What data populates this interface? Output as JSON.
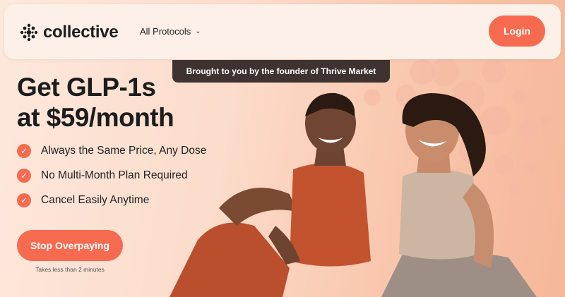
{
  "header": {
    "logo_text": "collective",
    "nav_label": "All Protocols",
    "login_label": "Login"
  },
  "banner": {
    "text": "Brought to you by the founder of Thrive Market"
  },
  "hero": {
    "headline_line1": "Get GLP-1s",
    "headline_line2": "at $59/month",
    "features": [
      {
        "label": "Always the Same Price, Any Dose"
      },
      {
        "label": "No Multi-Month Plan Required"
      },
      {
        "label": "Cancel Easily Anytime"
      }
    ],
    "cta_label": "Stop Overpaying",
    "cta_note": "Takes less than 2 minutes"
  },
  "colors": {
    "accent": "#f66a4f",
    "banner_bg": "#3e3331",
    "header_bg": "#fdf0e8",
    "page_bg": "#fbd9c4"
  },
  "icons": [
    "collective-logo-icon",
    "chevron-down-icon",
    "checkmark-icon"
  ]
}
